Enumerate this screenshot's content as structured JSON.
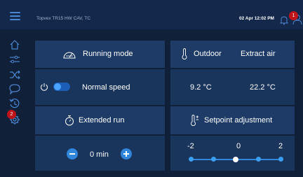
{
  "header": {
    "device_title": "Topvex TR15 HW CAV, TC",
    "datetime": "02 Apr 12:02 PM",
    "notification_count": "1"
  },
  "sidebar": {
    "alarm_count": "2",
    "items": [
      {
        "icon": "home-icon"
      },
      {
        "icon": "sliders-icon"
      },
      {
        "icon": "shuffle-icon"
      },
      {
        "icon": "chat-icon"
      },
      {
        "icon": "history-icon"
      },
      {
        "icon": "settings-icon"
      }
    ]
  },
  "running_mode": {
    "title": "Running mode",
    "speed_label": "Normal speed",
    "toggle_on": true
  },
  "extended_run": {
    "title": "Extended run",
    "value": "0 min"
  },
  "temperatures": {
    "outdoor_label": "Outdoor",
    "outdoor_value": "9.2 °C",
    "extract_label": "Extract air",
    "extract_value": "22.2 °C"
  },
  "setpoint": {
    "title": "Setpoint adjustment",
    "tick_labels": [
      "-2",
      "0",
      "2"
    ],
    "value": 0,
    "min": -2,
    "max": 2
  },
  "colors": {
    "background": "#0f2038",
    "panel": "#1d3b66",
    "accent": "#2f86dc",
    "badge": "#c0141b"
  }
}
